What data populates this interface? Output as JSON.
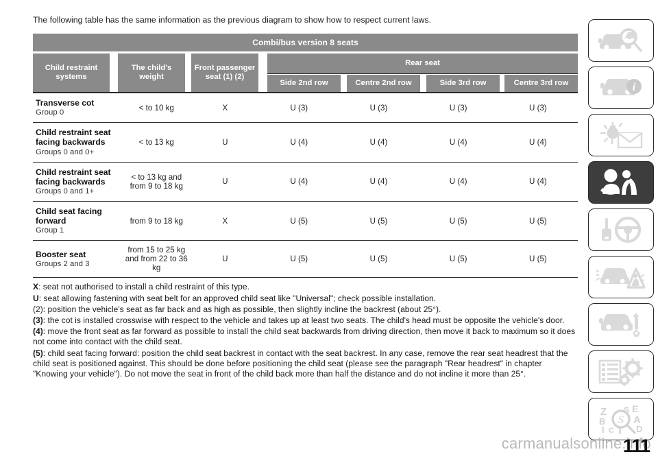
{
  "intro": "The following table has the same information as the previous diagram to show how to respect current laws.",
  "table": {
    "title": "Combi/bus version 8 seats",
    "rear_group_label": "Rear seat",
    "headers": {
      "systems": "Child restraint systems",
      "weight": "The child's weight",
      "front": "Front passenger seat (1) (2)",
      "rear": [
        "Side 2nd row",
        "Centre 2nd row",
        "Side 3rd row",
        "Centre 3rd row"
      ]
    },
    "rows": [
      {
        "system": "Transverse cot",
        "group": "Group 0",
        "weight": "< to 10 kg",
        "front": "X",
        "rear": [
          "U (3)",
          "U (3)",
          "U (3)",
          "U (3)"
        ]
      },
      {
        "system": "Child restraint seat facing backwards",
        "group": "Groups 0 and 0+",
        "weight": "< to 13 kg",
        "front": "U",
        "rear": [
          "U (4)",
          "U (4)",
          "U (4)",
          "U (4)"
        ]
      },
      {
        "system": "Child restraint seat facing backwards",
        "group": "Groups 0 and 1+",
        "weight": "< to 13 kg and from 9 to 18 kg",
        "front": "U",
        "rear": [
          "U (4)",
          "U (4)",
          "U (4)",
          "U (4)"
        ]
      },
      {
        "system": "Child seat facing forward",
        "group": "Group 1",
        "weight": "from 9 to 18 kg",
        "front": "X",
        "rear": [
          "U (5)",
          "U (5)",
          "U (5)",
          "U (5)"
        ]
      },
      {
        "system": "Booster seat",
        "group": "Groups 2 and 3",
        "weight": "from 15 to 25 kg and from 22 to 36 kg",
        "front": "U",
        "rear": [
          "U (5)",
          "U (5)",
          "U (5)",
          "U (5)"
        ]
      }
    ]
  },
  "notes": [
    {
      "key": "X",
      "text": ": seat not authorised to install a child restraint of this type."
    },
    {
      "key": "U",
      "text": ": seat allowing fastening with seat belt for an approved child seat like \"Universal\"; check possible installation."
    },
    {
      "key": "(2)",
      "text": ": position the vehicle's seat as far back and as high as possible, then slightly incline the backrest (about 25°)."
    },
    {
      "key": "(3)",
      "text": ": the cot is installed crosswise with respect to the vehicle and takes up at least two seats. The child's head must be opposite the vehicle's door."
    },
    {
      "key": "(4)",
      "text": ": move the front seat as far forward as possible to install the child seat backwards from driving direction, then move it back to maximum so it does not come into contact with the child seat."
    },
    {
      "key": "(5)",
      "text": ": child seat facing forward: position the child seat backrest in contact with the seat backrest. In any case, remove the rear seat headrest that the child seat is positioned against. This should be done before positioning the child seat (please see the paragraph \"Rear headrest\" in chapter \"Knowing your vehicle\"). Do not move the seat in front of the child back more than half the distance and do not incline it more than 25°."
    }
  ],
  "sidebar": {
    "items": [
      {
        "icon": "car-inspection-icon",
        "active": false
      },
      {
        "icon": "car-info-icon",
        "active": false
      },
      {
        "icon": "warning-lights-messages-icon",
        "active": false
      },
      {
        "icon": "occupant-safety-seatbelt-icon",
        "active": true
      },
      {
        "icon": "key-steering-wheel-starting-icon",
        "active": false
      },
      {
        "icon": "emergency-breakdown-icon",
        "active": false
      },
      {
        "icon": "car-maintenance-icon",
        "active": false
      },
      {
        "icon": "technical-specifications-icon",
        "active": false
      },
      {
        "icon": "alphabetical-index-icon",
        "active": false
      }
    ]
  },
  "footer": {
    "page_number": "111",
    "watermark": "carmanualsonline.info"
  },
  "colors": {
    "header_gray": "#8a8a8a",
    "active_tab": "#3d3d3d",
    "rule": "#2a2a2a",
    "watermark": "#b9b9b9"
  }
}
